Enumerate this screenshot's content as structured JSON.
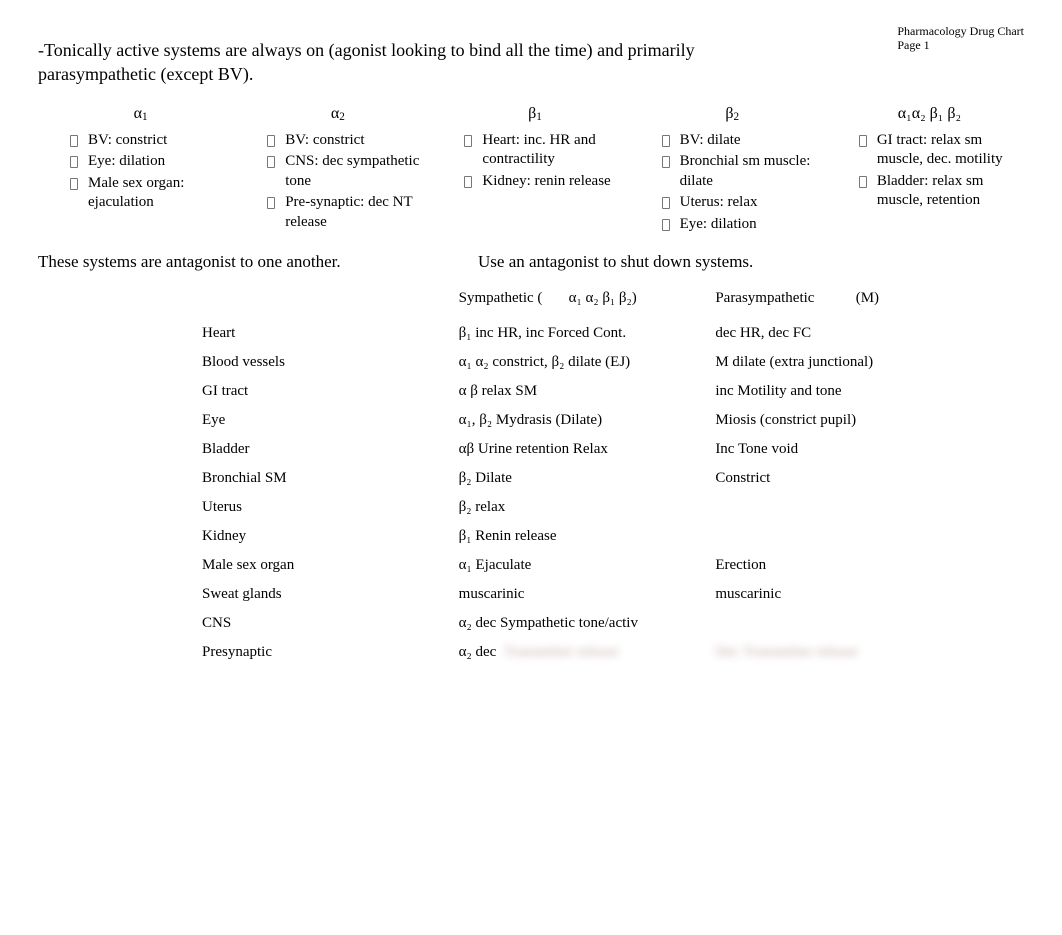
{
  "header": {
    "title": "Pharmacology Drug Chart",
    "page": "Page 1"
  },
  "intro": "-Tonically active systems are always on (agonist looking to bind all the time) and primarily parasympathetic (except BV).",
  "receptors": [
    {
      "label": "α",
      "sub": "1",
      "items": [
        "BV: constrict",
        "Eye: dilation",
        "Male sex organ: ejaculation"
      ]
    },
    {
      "label": "α",
      "sub": "2",
      "items": [
        "BV: constrict",
        "CNS: dec sympathetic tone",
        "Pre-synaptic: dec NT release"
      ]
    },
    {
      "label": "β",
      "sub": "1",
      "items": [
        "Heart: inc. HR and contractility",
        "Kidney: renin release"
      ]
    },
    {
      "label": "β",
      "sub": "2",
      "items": [
        "BV: dilate",
        "Bronchial sm muscle: dilate",
        "Uterus: relax",
        "Eye: dilation"
      ]
    },
    {
      "label": "α₁α₂ β₁ β₂",
      "sub": "",
      "items": [
        "GI tract: relax sm muscle, dec. motility",
        "Bladder: relax sm muscle, retention"
      ]
    }
  ],
  "midline": {
    "a": "These systems are antagonist to one another.",
    "b": "Use an antagonist to shut down systems."
  },
  "table": {
    "head": {
      "symp_a": "Sympathetic (",
      "symp_b": "α₁ α₂ β₁ β₂)",
      "para_a": "Parasympathetic",
      "para_b": "(M)"
    },
    "rows": [
      {
        "k": "Heart",
        "s": "β₁    inc HR,     inc Forced Cont.",
        "p": "  dec HR, dec FC"
      },
      {
        "k": "Blood vessels",
        "s": "α₁ α₂ constrict,    β₂ dilate (EJ)",
        "p": "M dilate      (extra junctional)"
      },
      {
        "k": "GI tract",
        "s": "α  β relax SM",
        "p": " inc Motility and tone"
      },
      {
        "k": "Eye",
        "s": "α₁,  β₂  Mydrasis (Dilate)",
        "p": "Miosis    (constrict pupil)"
      },
      {
        "k": "Bladder",
        "s": "αβ  Urine retention Relax",
        "p": " Inc Tone void"
      },
      {
        "k": "Bronchial SM",
        "s": "β₂  Dilate",
        "p": "Constrict"
      },
      {
        "k": "Uterus",
        "s": "β₂  relax",
        "p": ""
      },
      {
        "k": "Kidney",
        "s": "β₁ Renin release",
        "p": ""
      },
      {
        "k": "Male sex organ",
        "s": "α₁  Ejaculate",
        "p": "Erection"
      },
      {
        "k": "Sweat glands",
        "s": "muscarinic",
        "p": "muscarinic"
      },
      {
        "k": "CNS",
        "s": "α₂  dec Sympathetic tone/activ",
        "p": ""
      },
      {
        "k": "Presynaptic",
        "s": "α₂   dec",
        "p": ""
      }
    ],
    "blur": {
      "a": "Transmitter release",
      "b": "Dec Transmitter release"
    }
  }
}
